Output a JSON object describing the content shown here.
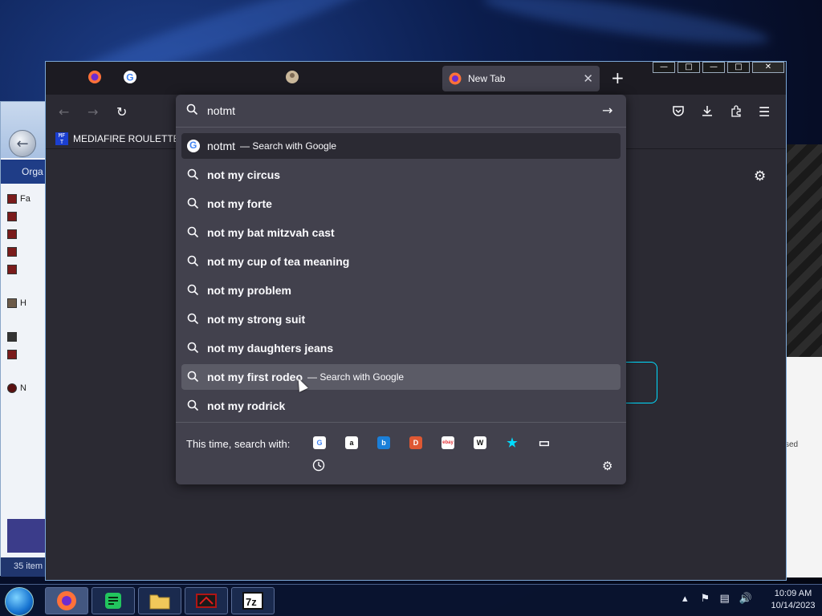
{
  "firefox": {
    "tab_title": "New Tab",
    "bookmarks": [
      {
        "favicon_text": "MF T",
        "label": "MEDIAFIRE ROULETTER"
      }
    ],
    "urlbar": {
      "value": "notmt",
      "action_text": "— Search with Google",
      "suggestions": [
        {
          "text": "notmt",
          "bold": false,
          "action": "— Search with Google",
          "state": "selected",
          "icon": "google-icon"
        },
        {
          "text": "not my circus",
          "bold": true,
          "icon": "search-icon"
        },
        {
          "text": "not my forte",
          "bold": true,
          "icon": "search-icon"
        },
        {
          "text": "not my bat mitzvah cast",
          "bold": true,
          "icon": "search-icon"
        },
        {
          "text": "not my cup of tea meaning",
          "bold": true,
          "icon": "search-icon"
        },
        {
          "text": "not my problem",
          "bold": true,
          "icon": "search-icon"
        },
        {
          "text": "not my strong suit",
          "bold": true,
          "icon": "search-icon"
        },
        {
          "text": "not my daughters jeans",
          "bold": true,
          "icon": "search-icon"
        },
        {
          "text": "not my first rodeo",
          "bold": true,
          "action": "— Search with Google",
          "state": "hovered",
          "icon": "search-icon"
        },
        {
          "text": "not my rodrick",
          "bold": true,
          "icon": "search-icon"
        }
      ],
      "one_off_label": "This time, search with:",
      "engines": [
        {
          "name": "google-icon",
          "glyph": "G",
          "color": "#4285f4",
          "bg": "#ffffff"
        },
        {
          "name": "amazon-icon",
          "glyph": "a",
          "color": "#111111",
          "bg": "#ffffff"
        },
        {
          "name": "bing-icon",
          "glyph": "b",
          "color": "#ffffff",
          "bg": "#1b7fd8"
        },
        {
          "name": "duckduckgo-icon",
          "glyph": "D",
          "color": "#ffffff",
          "bg": "#de5833"
        },
        {
          "name": "ebay-icon",
          "glyph": "ebay",
          "color": "#e53238",
          "bg": "#ffffff"
        },
        {
          "name": "wikipedia-icon",
          "glyph": "W",
          "color": "#111111",
          "bg": "#ffffff"
        },
        {
          "name": "bookmarks-star-icon",
          "glyph": "★",
          "color": "#00ddff",
          "bg": "transparent"
        },
        {
          "name": "tabs-icon",
          "glyph": "▭",
          "color": "#fbfbfe",
          "bg": "transparent"
        }
      ]
    }
  },
  "explorer": {
    "organize_label": "Orga",
    "tree_items": [
      "Fa",
      "",
      "",
      "",
      "",
      "H",
      "",
      "",
      "N"
    ],
    "status": "35 item"
  },
  "widget": {
    "labels": [
      "",
      "",
      "",
      ""
    ],
    "side_text": "sed"
  },
  "taskbar": {
    "time": "10:09 AM",
    "date": "10/14/2023"
  },
  "colors": {
    "accent": "#00ddff",
    "toolbar": "#2b2a33",
    "panel": "#42414d",
    "tabstrip": "#1c1b22"
  }
}
